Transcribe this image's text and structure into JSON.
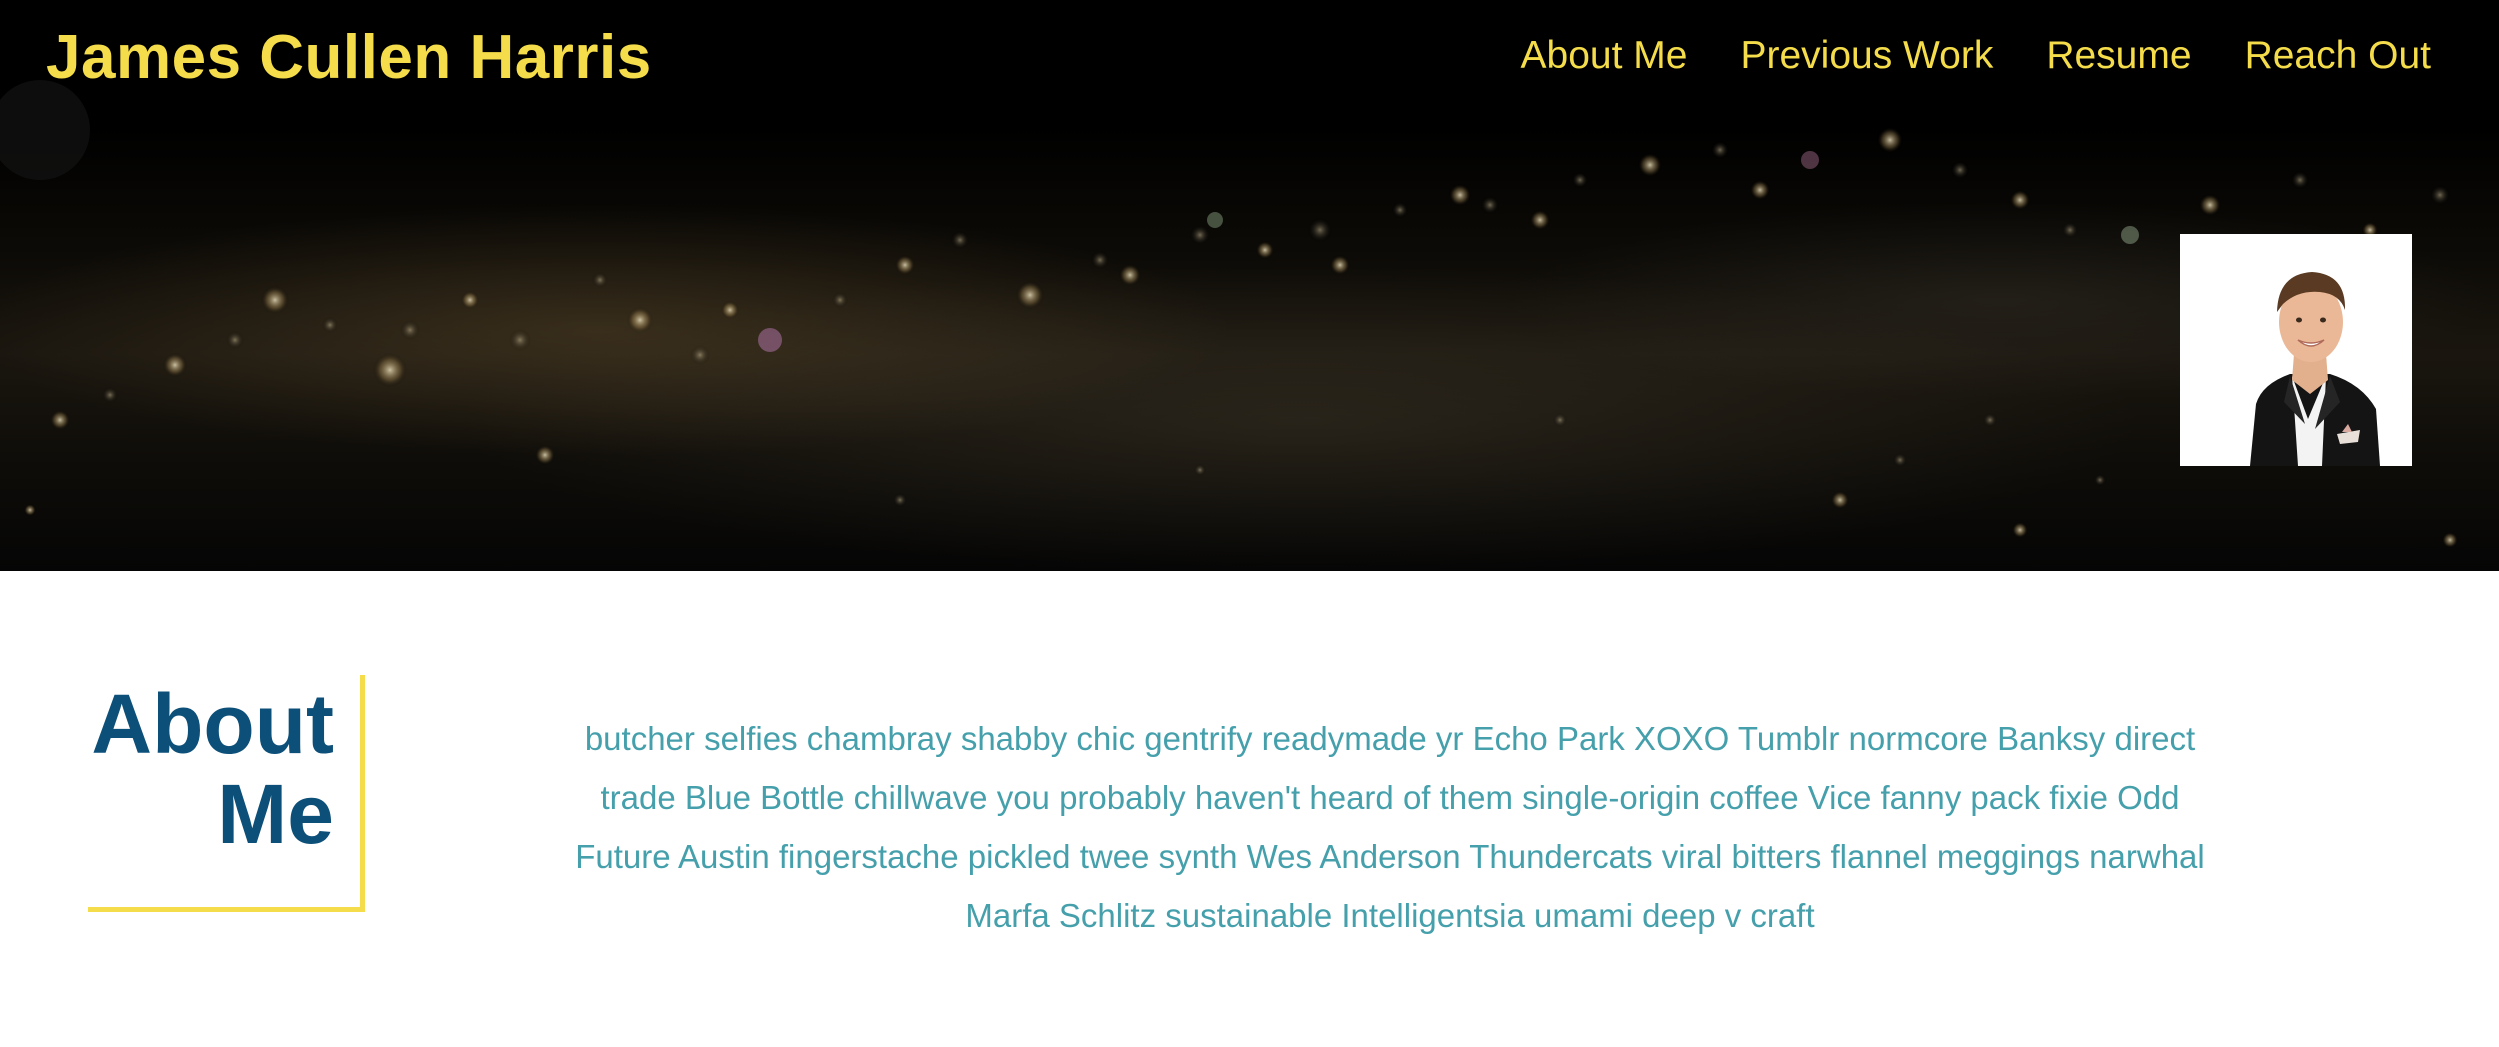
{
  "header": {
    "site_title": "James Cullen Harris",
    "nav": [
      {
        "label": "About Me"
      },
      {
        "label": "Previous Work"
      },
      {
        "label": "Resume"
      },
      {
        "label": "Reach Out"
      }
    ]
  },
  "hero": {
    "avatar_icon": "portrait-photo"
  },
  "about": {
    "heading_line1": "About",
    "heading_line2": "Me",
    "body": "butcher selfies chambray shabby chic gentrify readymade yr Echo Park XOXO Tumblr normcore Banksy direct trade Blue Bottle chillwave you probably haven't heard of them single-origin coffee Vice fanny pack fixie Odd Future Austin fingerstache pickled twee synth Wes Anderson Thundercats viral bitters flannel meggings narwhal Marfa Schlitz sustainable Intelligentsia umami deep v craft"
  },
  "colors": {
    "accent": "#f4dc4a",
    "heading": "#0c4f78",
    "body_text": "#45a0ac",
    "hero_bg": "#000000"
  }
}
